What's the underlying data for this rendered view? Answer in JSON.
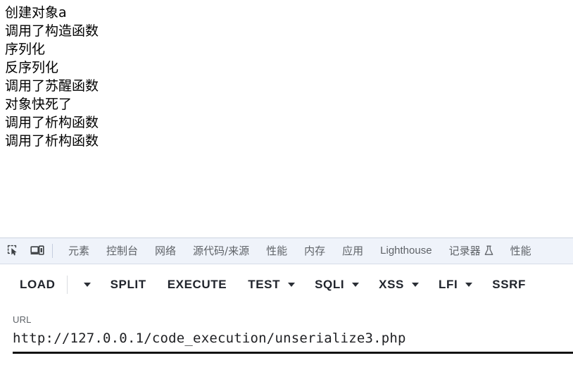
{
  "page_output": {
    "lines": [
      "创建对象a",
      "调用了构造函数",
      "序列化",
      "反序列化",
      "调用了苏醒函数",
      "对象快死了",
      "调用了析构函数",
      "调用了析构函数"
    ]
  },
  "devtools": {
    "icons": [
      {
        "name": "inspect-element-icon",
        "title": "检查元素"
      },
      {
        "name": "device-toolbar-icon",
        "title": "切换设备工具栏"
      }
    ],
    "tabs": [
      {
        "label": "元素",
        "script": "cjk"
      },
      {
        "label": "控制台",
        "script": "cjk"
      },
      {
        "label": "网络",
        "script": "cjk"
      },
      {
        "label": "源代码/来源",
        "script": "cjk"
      },
      {
        "label": "性能",
        "script": "cjk"
      },
      {
        "label": "内存",
        "script": "cjk"
      },
      {
        "label": "应用",
        "script": "cjk"
      },
      {
        "label": "Lighthouse",
        "script": "latin"
      },
      {
        "label": "记录器",
        "script": "cjk",
        "badge": "flask-icon"
      },
      {
        "label": "性能",
        "script": "cjk",
        "clipped": true
      }
    ]
  },
  "action_toolbar": {
    "buttons": [
      {
        "label": "LOAD",
        "has_caret": true,
        "has_separator": true
      },
      {
        "label": "SPLIT",
        "has_caret": false,
        "has_separator": false
      },
      {
        "label": "EXECUTE",
        "has_caret": false,
        "has_separator": false
      },
      {
        "label": "TEST",
        "has_caret": true,
        "has_separator": false
      },
      {
        "label": "SQLI",
        "has_caret": true,
        "has_separator": false
      },
      {
        "label": "XSS",
        "has_caret": true,
        "has_separator": false
      },
      {
        "label": "LFI",
        "has_caret": true,
        "has_separator": false
      },
      {
        "label": "SSRF",
        "has_caret": false,
        "has_separator": false
      }
    ]
  },
  "url_field": {
    "label": "URL",
    "value": "http://127.0.0.1/code_execution/unserialize3.php",
    "placeholder": "URL"
  },
  "colors": {
    "devtools_bar_bg": "#eff3fa",
    "devtools_tab_text": "#5f6368",
    "action_text": "#20242c",
    "underline": "#121212",
    "page_text": "#000000"
  }
}
